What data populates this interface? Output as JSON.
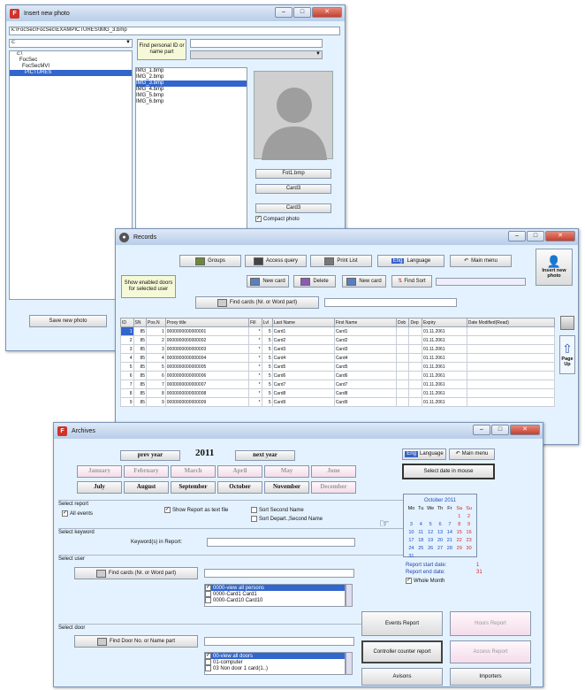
{
  "insert_window": {
    "title": "Insert new photo",
    "path": "k:\\FocSec\\FocSec\\EXAMPICTURES\\IMG_3.bmp",
    "drive": "c:",
    "folders": [
      "c:\\",
      "FocSec",
      "FocSecMVI",
      "PICTURES"
    ],
    "search_label": "Find personal ID or name part",
    "files": [
      "IMG_1.bmp",
      "IMG_2.bmp",
      "IMG_3.bmp",
      "IMG_4.bmp",
      "IMG_5.bmp",
      "IMG_6.bmp"
    ],
    "selected_file_index": 2,
    "photo_field_1": "Fot1.bmp",
    "photo_field_2": "Card3",
    "photo_field_3": "Card3",
    "compact_label": "Compact photo",
    "save_button": "Save new photo"
  },
  "records_window": {
    "title": "Records",
    "buttons": {
      "groups": "Groups",
      "access": "Access query",
      "print": "Print List",
      "language_prefix": "Eng",
      "language": "Language",
      "main": "Main menu",
      "insert_photo": "Insert new photo",
      "show_doors": "Show enabled doors for selected user",
      "new_card": "New card",
      "delete": "Delete",
      "new_card2": "New card",
      "find_sort": "Find Sort",
      "find_cards": "Find cards (Nr. or Word part)",
      "page_up": "Page Up"
    },
    "columns": [
      "ID",
      "SN",
      "Pos.N",
      "Proxy title",
      "Fill",
      "Lvl",
      "Last Name",
      "First Name",
      "Dob",
      "Dep",
      "Expiry",
      "Date Modified(Read)"
    ],
    "rows": [
      [
        "1",
        "85",
        "1",
        "0000000000000001",
        "*",
        "5",
        "Card1",
        "Card1",
        "",
        "",
        "01.11.2061",
        ""
      ],
      [
        "2",
        "85",
        "2",
        "0000000000000002",
        "*",
        "5",
        "Card2",
        "Card2",
        "",
        "",
        "01.11.2061",
        ""
      ],
      [
        "3",
        "85",
        "3",
        "0000000000000003",
        "*",
        "5",
        "Card3",
        "Card3",
        "",
        "",
        "01.11.2061",
        ""
      ],
      [
        "4",
        "85",
        "4",
        "0000000000000004",
        "*",
        "5",
        "Card4",
        "Card4",
        "",
        "",
        "01.11.2061",
        ""
      ],
      [
        "5",
        "85",
        "5",
        "0000000000000005",
        "*",
        "5",
        "Card5",
        "Card5",
        "",
        "",
        "01.11.2061",
        ""
      ],
      [
        "6",
        "85",
        "6",
        "0000000000000006",
        "*",
        "5",
        "Card6",
        "Card6",
        "",
        "",
        "01.11.2061",
        ""
      ],
      [
        "7",
        "85",
        "7",
        "0000000000000007",
        "*",
        "5",
        "Card7",
        "Card7",
        "",
        "",
        "01.11.2061",
        ""
      ],
      [
        "8",
        "85",
        "8",
        "0000000000000008",
        "*",
        "5",
        "Card8",
        "Card8",
        "",
        "",
        "01.11.2061",
        ""
      ],
      [
        "9",
        "85",
        "9",
        "0000000000000009",
        "*",
        "5",
        "Card9",
        "Card9",
        "",
        "",
        "01.11.2061",
        ""
      ]
    ]
  },
  "archives_window": {
    "title": "Archives",
    "prev_year": "prev year",
    "year": "2011",
    "next_year": "next year",
    "months_row1": [
      "January",
      "February",
      "March",
      "April",
      "May",
      "June"
    ],
    "months_row2": [
      "July",
      "August",
      "September",
      "October",
      "November",
      "December"
    ],
    "select_report": "Select report",
    "all_events": "All events",
    "show_as_text": "Show Report as text file",
    "sort_second": "Sort Second Name",
    "sort_depart": "Sort Depart.,Second Name",
    "select_keyword": "Select keyword",
    "keywords_label": "Keyword(s) in Report:",
    "select_user": "Select user",
    "find_cards": "Find cards (Nr. or Word part)",
    "users": [
      "0000-view all persons",
      "0000-Card1 Card1",
      "0000-Card10 Card10"
    ],
    "select_door": "Select door",
    "find_door": "Find Door No. or Name part",
    "doors": [
      "00-view all doors",
      "01-computer",
      "03 Non door 1 card(1..)"
    ],
    "language_prefix": "Eng",
    "language": "Language",
    "main_menu": "Main menu",
    "select_date": "Select date in mouse",
    "calendar_title": "October 2011",
    "weekdays": [
      "Mo",
      "Tu",
      "We",
      "Th",
      "Fr",
      "Sa",
      "Su"
    ],
    "weeks": [
      [
        "",
        "",
        "",
        "",
        "",
        "1",
        "2"
      ],
      [
        "3",
        "4",
        "5",
        "6",
        "7",
        "8",
        "9"
      ],
      [
        "10",
        "11",
        "12",
        "13",
        "14",
        "15",
        "16"
      ],
      [
        "17",
        "18",
        "19",
        "20",
        "21",
        "22",
        "23"
      ],
      [
        "24",
        "25",
        "26",
        "27",
        "28",
        "29",
        "30"
      ],
      [
        "31",
        "",
        "",
        "",
        "",
        "",
        ""
      ]
    ],
    "report_start_label": "Report start date:",
    "report_start_value": "1",
    "report_end_label": "Report end date:",
    "report_end_value": "31",
    "whole_month": "Whole Month",
    "events_report": "Events Report",
    "hours_report": "Hours Report",
    "controller_report": "Controller counter report",
    "access_report": "Access Report",
    "avisons": "Avisons",
    "importers": "Importers"
  }
}
